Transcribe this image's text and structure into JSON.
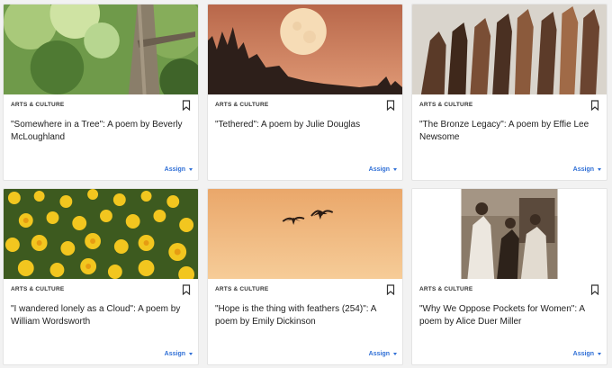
{
  "cards": [
    {
      "image_icon": "tree-photo-icon",
      "category": "ARTS & CULTURE",
      "title": "\"Somewhere in a Tree\": A poem by Beverly McLoughland",
      "assign_label": "Assign"
    },
    {
      "image_icon": "full-moon-photo-icon",
      "category": "ARTS & CULTURE",
      "title": "\"Tethered\": A poem by Julie Douglas",
      "assign_label": "Assign"
    },
    {
      "image_icon": "raised-hands-photo-icon",
      "category": "ARTS & CULTURE",
      "title": "\"The Bronze Legacy\": A poem by Effie Lee Newsome",
      "assign_label": "Assign"
    },
    {
      "image_icon": "daffodils-photo-icon",
      "category": "ARTS & CULTURE",
      "title": "\"I wandered lonely as a Cloud\": A poem by William Wordsworth",
      "assign_label": "Assign"
    },
    {
      "image_icon": "birds-in-sky-photo-icon",
      "category": "ARTS & CULTURE",
      "title": "\"Hope is the thing with feathers (254)\": A poem by Emily Dickinson",
      "assign_label": "Assign"
    },
    {
      "image_icon": "vintage-women-photo-icon",
      "category": "ARTS & CULTURE",
      "title": "\"Why We Oppose Pockets for Women\": A poem by Alice Duer Miller",
      "assign_label": "Assign"
    }
  ],
  "colors": {
    "accent": "#2f6fd6",
    "card_bg": "#ffffff",
    "page_bg": "#f2f2f2"
  }
}
